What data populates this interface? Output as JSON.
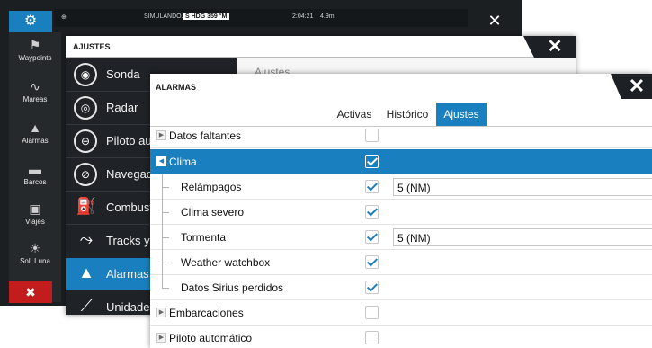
{
  "status_bar": {
    "left_icon": "gps-icon",
    "mode": "SIMULANDO...",
    "heading": "S HDG 359 °M",
    "time": "2:04:21",
    "distance": "4.9m",
    "close_label": "✕"
  },
  "sidebar": {
    "home_icon": "gear-icon",
    "items": [
      {
        "label": "Waypoints",
        "icon": "flag-icon"
      },
      {
        "label": "Mareas",
        "icon": "tide-wave-icon"
      },
      {
        "label": "Alarmas",
        "icon": "bell-icon"
      },
      {
        "label": "Barcos",
        "icon": "boat-icon"
      },
      {
        "label": "Viajes",
        "icon": "trip-icon"
      },
      {
        "label": "Sol, Luna",
        "icon": "sun-moon-icon"
      }
    ],
    "cancel_icon": "cross-icon"
  },
  "ajustes": {
    "title": "AJUSTES",
    "close_label": "✕",
    "placeholder": "Ajustes...",
    "menu": [
      {
        "label": "Sonda",
        "icon": "sonar-icon",
        "active": false
      },
      {
        "label": "Radar",
        "icon": "radar-icon",
        "active": false
      },
      {
        "label": "Piloto aut",
        "icon": "autopilot-wheel-icon",
        "active": false
      },
      {
        "label": "Navegaci",
        "icon": "compass-icon",
        "active": false
      },
      {
        "label": "Combusti",
        "icon": "fuel-pump-icon",
        "active": false
      },
      {
        "label": "Tracks y v",
        "icon": "tracks-icon",
        "active": false
      },
      {
        "label": "Alarmas",
        "icon": "bell-icon",
        "active": true
      },
      {
        "label": "Unidades",
        "icon": "ruler-icon",
        "active": false
      }
    ]
  },
  "alarmas": {
    "title": "ALARMAS",
    "close_label": "✕",
    "tabs": [
      {
        "label": "Activas",
        "active": false
      },
      {
        "label": "Histórico",
        "active": false
      },
      {
        "label": "Ajustes",
        "active": true
      }
    ],
    "rows": [
      {
        "label": "Datos faltantes",
        "level": 0,
        "expander": "▶",
        "checked": false,
        "selected": false,
        "value": null
      },
      {
        "label": "Clima",
        "level": 0,
        "expander": "◀",
        "checked": true,
        "selected": true,
        "value": null
      },
      {
        "label": "Relámpagos",
        "level": 1,
        "checked": true,
        "selected": false,
        "value": "5 (NM)"
      },
      {
        "label": "Clima severo",
        "level": 1,
        "checked": true,
        "selected": false,
        "value": null
      },
      {
        "label": "Tormenta",
        "level": 1,
        "checked": true,
        "selected": false,
        "value": "5 (NM)"
      },
      {
        "label": "Weather watchbox",
        "level": 1,
        "checked": true,
        "selected": false,
        "value": null
      },
      {
        "label": "Datos Sirius perdidos",
        "level": 1,
        "checked": true,
        "selected": false,
        "value": null
      },
      {
        "label": "Embarcaciones",
        "level": 0,
        "expander": "▶",
        "checked": false,
        "selected": false,
        "value": null
      },
      {
        "label": "Piloto automático",
        "level": 0,
        "expander": "▶",
        "checked": false,
        "selected": false,
        "value": null
      }
    ]
  },
  "colors": {
    "accent": "#1a7fbf",
    "dark": "#1d2024",
    "cancel": "#c31c1c"
  }
}
